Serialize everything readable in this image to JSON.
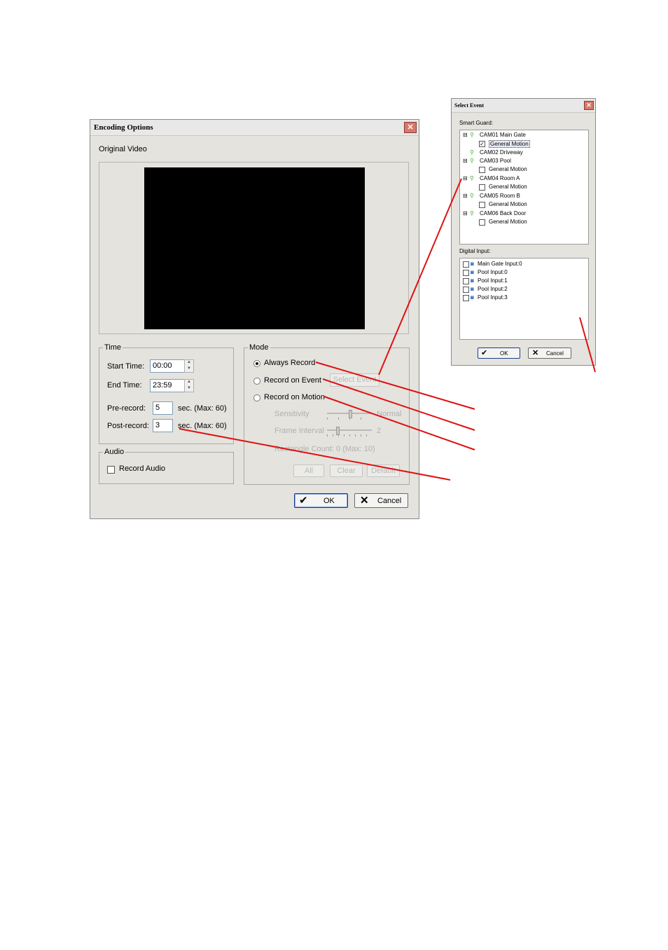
{
  "encoding_dialog": {
    "title": "Encoding Options",
    "original_video_label": "Original Video",
    "time_group": {
      "legend": "Time",
      "start_label": "Start Time:",
      "start_value": "00:00",
      "end_label": "End Time:",
      "end_value": "23:59",
      "prerecord_label": "Pre-record:",
      "prerecord_value": "5",
      "prerecord_unit": "sec. (Max: 60)",
      "postrecord_label": "Post-record:",
      "postrecord_value": "3",
      "postrecord_unit": "sec. (Max: 60)"
    },
    "audio_group": {
      "legend": "Audio",
      "record_audio_label": "Record Audio"
    },
    "mode_group": {
      "legend": "Mode",
      "always_record": "Always Record",
      "record_on_event": "Record on Event",
      "select_event_button": "Select Event",
      "record_on_motion": "Record on Motion",
      "sensitivity_label": "Sensitivity",
      "sensitivity_value": "Normal",
      "frame_interval_label": "Frame Interval",
      "frame_interval_value": "2",
      "rectangle_count": "Rectangle Count: 0  (Max: 10)",
      "all_button": "All",
      "clear_button": "Clear",
      "default_button": "Default"
    },
    "ok_button": "OK",
    "cancel_button": "Cancel"
  },
  "select_event_dialog": {
    "title": "Select Event",
    "smart_guard_label": "Smart Guard:",
    "smart_guard_tree": [
      {
        "camera": "CAM01 Main Gate",
        "event": "General Motion"
      },
      {
        "camera": "CAM02 Driveway",
        "event": ""
      },
      {
        "camera": "CAM03 Pool",
        "event": "General Motion"
      },
      {
        "camera": "CAM04 Room A",
        "event": "General Motion"
      },
      {
        "camera": "CAM05 Room B",
        "event": "General Motion"
      },
      {
        "camera": "CAM06 Back Door",
        "event": "General Motion"
      }
    ],
    "digital_input_label": "Digital Input:",
    "digital_inputs": [
      "Main Gate Input:0",
      "Pool Input:0",
      "Pool Input:1",
      "Pool Input:2",
      "Pool Input:3"
    ],
    "ok_button": "OK",
    "cancel_button": "Cancel"
  },
  "colors": {
    "annotation_line": "#e01010",
    "dialog_bg": "#e4e3de",
    "camera_icon": "#3fae2a"
  }
}
